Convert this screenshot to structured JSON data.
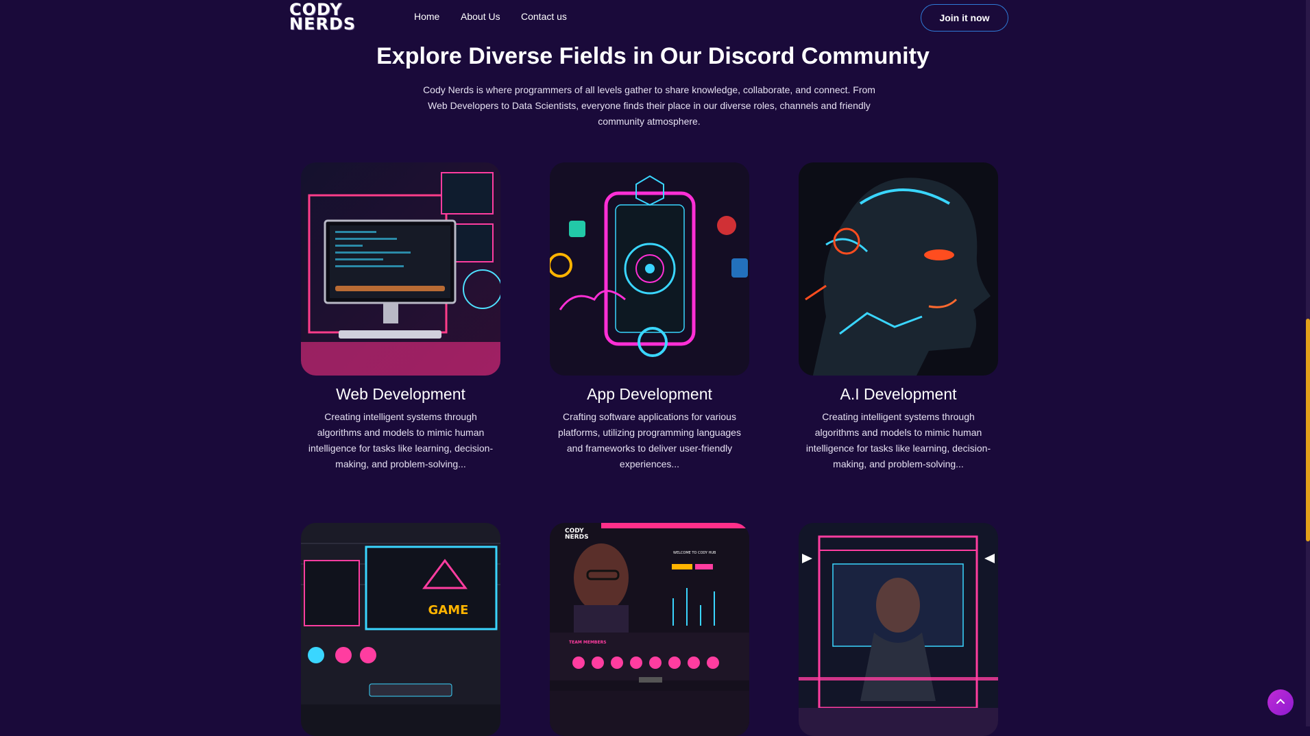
{
  "nav": {
    "logo_line1": "CODY",
    "logo_line2": "NERDS",
    "links": [
      "Home",
      "About Us",
      "Contact us"
    ],
    "cta": "Join it now"
  },
  "hero": {
    "title": "Explore Diverse Fields in Our Discord Community",
    "description": "Cody Nerds is where programmers of all levels gather to share knowledge, collaborate, and connect. From Web Developers to Data Scientists, everyone finds their place in our diverse roles, channels and friendly community atmosphere."
  },
  "cards": [
    {
      "title": "Web Development",
      "description": "Creating intelligent systems through algorithms and models to mimic human intelligence for tasks like learning, decision-making, and problem-solving..."
    },
    {
      "title": "App Development",
      "description": "Crafting software applications for various platforms, utilizing programming languages and frameworks to deliver user-friendly experiences..."
    },
    {
      "title": "A.I Development",
      "description": "Creating intelligent systems through algorithms and models to mimic human intelligence for tasks like learning, decision-making, and problem-solving..."
    }
  ],
  "image_text": {
    "site_logo_1": "CODY",
    "site_logo_2": "NERDS",
    "welcome": "WELCOME TO CODY HUB",
    "team": "TEAM MEMBERS",
    "game": "GAME"
  },
  "colors": {
    "background": "#1a0a3a",
    "button_border": "#2f7bd8",
    "scroll_thumb": "#e2a11a",
    "to_top": "#b02bd6"
  },
  "icons": {
    "to_top": "chevron-up-icon"
  }
}
